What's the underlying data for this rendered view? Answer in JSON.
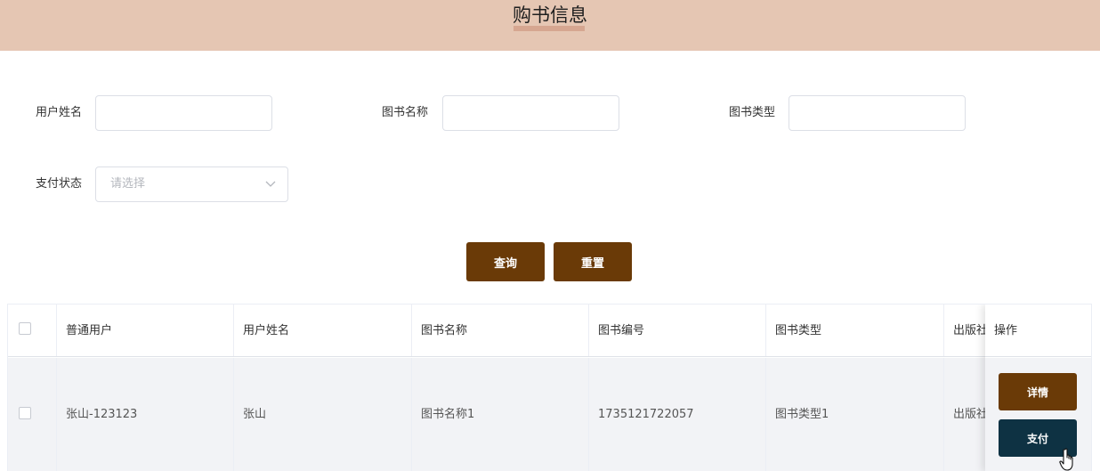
{
  "header": {
    "title": "购书信息"
  },
  "filters": {
    "user_name_label": "用户姓名",
    "book_name_label": "图书名称",
    "book_type_label": "图书类型",
    "pay_status_label": "支付状态",
    "pay_status_placeholder": "请选择",
    "user_name_value": "",
    "book_name_value": "",
    "book_type_value": ""
  },
  "actions": {
    "search_label": "查询",
    "reset_label": "重置"
  },
  "table": {
    "columns": [
      "普通用户",
      "用户姓名",
      "图书名称",
      "图书编号",
      "图书类型",
      "出版社",
      "操作"
    ],
    "rows": [
      {
        "cells": [
          "张山-123123",
          "张山",
          "图书名称1",
          "1735121722057",
          "图书类型1",
          "出版社"
        ],
        "detail_label": "详情",
        "pay_label": "支付"
      }
    ]
  },
  "colors": {
    "header_bg": "#e5c6b3",
    "brand_brown": "#6a3a07",
    "pay_navy": "#0e3243"
  },
  "icons": {
    "select_arrow": "chevron-down-icon",
    "pointer": "hand-cursor-icon"
  }
}
